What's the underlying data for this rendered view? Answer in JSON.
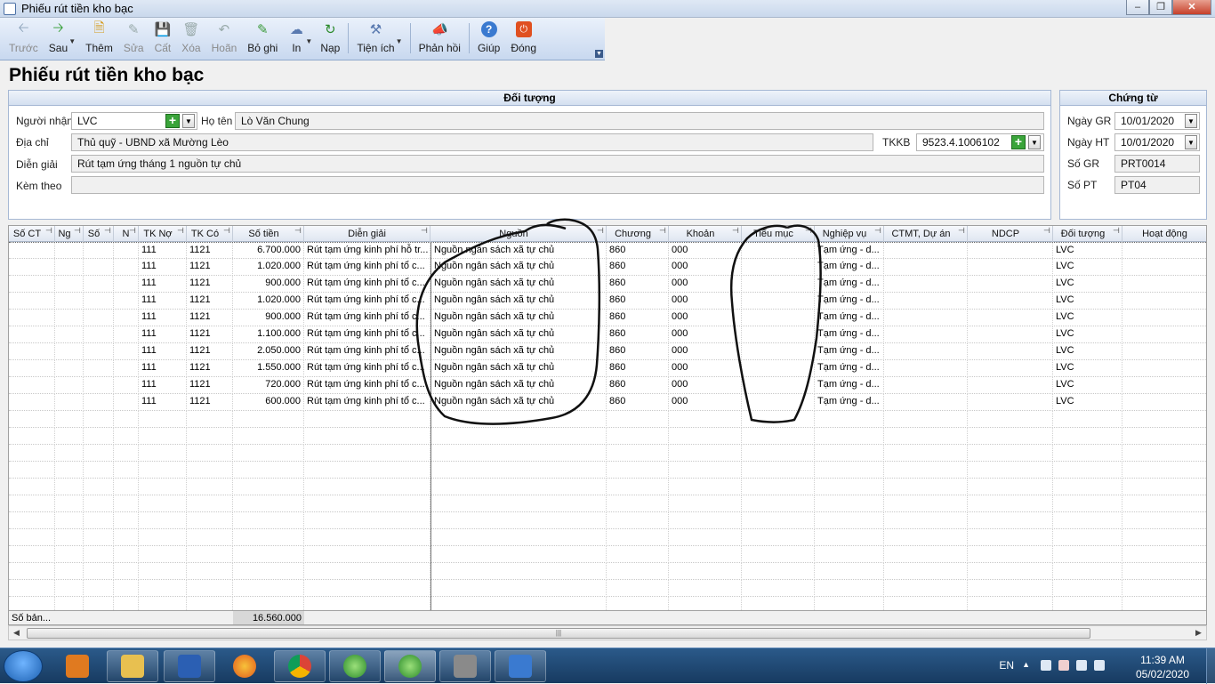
{
  "window": {
    "title": "Phiếu rút tiền kho bạc"
  },
  "toolbar": {
    "items": [
      {
        "label": "Trước",
        "icon": "arrow-left-icon"
      },
      {
        "label": "Sau",
        "icon": "arrow-right-icon"
      },
      {
        "label": "Thêm",
        "icon": "add-document-icon"
      },
      {
        "label": "Sửa",
        "icon": "edit-icon"
      },
      {
        "label": "Cất",
        "icon": "save-icon"
      },
      {
        "label": "Xóa",
        "icon": "delete-icon"
      },
      {
        "label": "Hoãn",
        "icon": "undo-icon"
      },
      {
        "label": "Bỏ ghi",
        "icon": "unpost-icon"
      },
      {
        "label": "In",
        "icon": "print-icon"
      },
      {
        "label": "Nạp",
        "icon": "refresh-icon"
      },
      {
        "label": "Tiện ích",
        "icon": "tools-icon"
      },
      {
        "label": "Phản hồi",
        "icon": "feedback-icon"
      },
      {
        "label": "Giúp",
        "icon": "help-icon"
      },
      {
        "label": "Đóng",
        "icon": "close-icon"
      }
    ]
  },
  "page_title": "Phiếu rút tiền kho bạc",
  "doi_tuong": {
    "header": "Đối tượng",
    "nguoi_nhan_label": "Người nhận",
    "nguoi_nhan_value": "LVC",
    "ho_ten_label": "Họ tên",
    "ho_ten_value": "Lò Văn Chung",
    "dia_chi_label": "Địa chỉ",
    "dia_chi_value": "Thủ quỹ - UBND xã Mường Lèo",
    "tkkb_label": "TKKB",
    "tkkb_value": "9523.4.1006102",
    "dien_giai_label": "Diễn giải",
    "dien_giai_value": "Rút tạm ứng tháng 1 nguồn tự chủ",
    "kem_theo_label": "Kèm theo",
    "kem_theo_value": ""
  },
  "chung_tu": {
    "header": "Chứng từ",
    "ngay_gr_label": "Ngày GR",
    "ngay_gr_value": "10/01/2020",
    "ngay_ht_label": "Ngày HT",
    "ngay_ht_value": "10/01/2020",
    "so_gr_label": "Số GR",
    "so_gr_value": "PRT0014",
    "so_pt_label": "Số PT",
    "so_pt_value": "PT04"
  },
  "grid": {
    "columns": [
      "Số CT",
      "Ng",
      "Số",
      "N",
      "TK Nợ",
      "TK Có",
      "Số tiền",
      "Diễn giải",
      "Nguồn",
      "Chương",
      "Khoản",
      "Tiểu mục",
      "Nghiệp vụ",
      "CTMT, Dự án",
      "NDCP",
      "Đối tượng",
      "Hoạt động"
    ],
    "rows": [
      {
        "tk_no": "111",
        "tk_co": "1121",
        "so_tien": "6.700.000",
        "dien_giai": "Rút tạm ứng kinh phí hỗ tr...",
        "nguon": "Nguồn ngân sách xã tự chủ",
        "chuong": "860",
        "khoan": "000",
        "tieu_muc": "",
        "nghiep_vu": "Tạm ứng - d...",
        "doi_tuong": "LVC"
      },
      {
        "tk_no": "111",
        "tk_co": "1121",
        "so_tien": "1.020.000",
        "dien_giai": "Rút tạm ứng kinh phí tổ c...",
        "nguon": "Nguồn ngân sách xã tự chủ",
        "chuong": "860",
        "khoan": "000",
        "tieu_muc": "",
        "nghiep_vu": "Tạm ứng - d...",
        "doi_tuong": "LVC"
      },
      {
        "tk_no": "111",
        "tk_co": "1121",
        "so_tien": "900.000",
        "dien_giai": "Rút tạm ứng kinh phí tổ c...",
        "nguon": "Nguồn ngân sách xã tự chủ",
        "chuong": "860",
        "khoan": "000",
        "tieu_muc": "",
        "nghiep_vu": "Tạm ứng - d...",
        "doi_tuong": "LVC"
      },
      {
        "tk_no": "111",
        "tk_co": "1121",
        "so_tien": "1.020.000",
        "dien_giai": "Rút tạm ứng kinh phí tổ c...",
        "nguon": "Nguồn ngân sách xã tự chủ",
        "chuong": "860",
        "khoan": "000",
        "tieu_muc": "",
        "nghiep_vu": "Tạm ứng - d...",
        "doi_tuong": "LVC"
      },
      {
        "tk_no": "111",
        "tk_co": "1121",
        "so_tien": "900.000",
        "dien_giai": "Rút tạm ứng kinh phí tổ c...",
        "nguon": "Nguồn ngân sách xã tự chủ",
        "chuong": "860",
        "khoan": "000",
        "tieu_muc": "",
        "nghiep_vu": "Tạm ứng - d...",
        "doi_tuong": "LVC"
      },
      {
        "tk_no": "111",
        "tk_co": "1121",
        "so_tien": "1.100.000",
        "dien_giai": "Rút tạm ứng kinh phí tổ c...",
        "nguon": "Nguồn ngân sách xã tự chủ",
        "chuong": "860",
        "khoan": "000",
        "tieu_muc": "",
        "nghiep_vu": "Tạm ứng - d...",
        "doi_tuong": "LVC"
      },
      {
        "tk_no": "111",
        "tk_co": "1121",
        "so_tien": "2.050.000",
        "dien_giai": "Rút tạm ứng kinh phí tổ c...",
        "nguon": "Nguồn ngân sách xã tự chủ",
        "chuong": "860",
        "khoan": "000",
        "tieu_muc": "",
        "nghiep_vu": "Tạm ứng - d...",
        "doi_tuong": "LVC"
      },
      {
        "tk_no": "111",
        "tk_co": "1121",
        "so_tien": "1.550.000",
        "dien_giai": "Rút tạm ứng kinh phí tổ c...",
        "nguon": "Nguồn ngân sách xã tự chủ",
        "chuong": "860",
        "khoan": "000",
        "tieu_muc": "",
        "nghiep_vu": "Tạm ứng - d...",
        "doi_tuong": "LVC"
      },
      {
        "tk_no": "111",
        "tk_co": "1121",
        "so_tien": "720.000",
        "dien_giai": "Rút tạm ứng kinh phí tổ c...",
        "nguon": "Nguồn ngân sách xã tự chủ",
        "chuong": "860",
        "khoan": "000",
        "tieu_muc": "",
        "nghiep_vu": "Tạm ứng - d...",
        "doi_tuong": "LVC"
      },
      {
        "tk_no": "111",
        "tk_co": "1121",
        "so_tien": "600.000",
        "dien_giai": "Rút tạm ứng kinh phí tổ c...",
        "nguon": "Nguồn ngân sách xã tự chủ",
        "chuong": "860",
        "khoan": "000",
        "tieu_muc": "",
        "nghiep_vu": "Tạm ứng - d...",
        "doi_tuong": "LVC"
      }
    ],
    "footer_label": "Số bản...",
    "footer_total": "16.560.000"
  },
  "taskbar": {
    "apps": [
      "media-player-icon",
      "file-explorer-icon",
      "word-icon",
      "firefox-icon",
      "chrome-icon",
      "accounting-app-icon",
      "accounting-app-icon",
      "printer-icon",
      "remote-desktop-icon"
    ],
    "language": "EN",
    "time": "11:39 AM",
    "date": "05/02/2020"
  }
}
